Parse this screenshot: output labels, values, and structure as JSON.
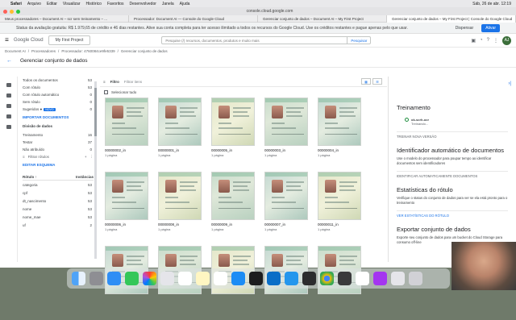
{
  "menubar": {
    "apple": "",
    "items": [
      "Safari",
      "Arquivo",
      "Editar",
      "Visualizar",
      "Histórico",
      "Favoritos",
      "Desenvolvedor",
      "Janela",
      "Ajuda"
    ],
    "datetime": "Sáb, 26 de abr. 12:19"
  },
  "browser": {
    "url": "console.cloud.google.com",
    "tabs": [
      "Meus processadores – Document AI – scr sem treinamento – ...",
      "Processador: Document AI — Console do Google Cloud",
      "Gerenciar conjunto de dados – Document AI – My First Project",
      "Gerenciar conjunto de dados – My First Project | Console do Google Cloud"
    ]
  },
  "banner": {
    "text": "Status da avaliação gratuita: R$ 1.979,65 de crédito e 46 dias restantes. Ative sua conta completa para ter acesso ilimitado a todos os recursos do Google Cloud. Use os créditos restantes e pague apenas pelo que usar.",
    "dismiss": "Dispensar",
    "activate": "Ativar"
  },
  "topbar": {
    "logo": "Google Cloud",
    "project": "My First Project",
    "search_placeholder": "Pesquise (/) recursos, documentos, produtos e muito mais",
    "search_button": "Pesquisar",
    "avatar": "AJ"
  },
  "breadcrumb": [
    "Document AI",
    "/",
    "Processadores",
    "/",
    "Processador: 4760084ce9fe5339",
    "/",
    "Gerenciar conjunto de dados"
  ],
  "page_title": "Gerenciar conjunto de dados",
  "left": {
    "counts": [
      {
        "label": "Todos os documentos",
        "value": "53"
      },
      {
        "label": "Com rótulo",
        "value": "53"
      },
      {
        "label": "Com rótulo automático",
        "value": "0"
      },
      {
        "label": "Sem rótulo",
        "value": "0"
      },
      {
        "label": "Sugeridos",
        "value": "0"
      }
    ],
    "suggest_badge": "NOVO",
    "import_btn": "IMPORTAR DOCUMENTOS",
    "split_head": "Divisão de dados",
    "split": [
      {
        "label": "Treinamento",
        "value": "16"
      },
      {
        "label": "Testar",
        "value": "37"
      },
      {
        "label": "Não atribuído",
        "value": "0"
      }
    ],
    "filter": "Filtrar rótulos",
    "edit_schema": "EDITAR ESQUEMA",
    "table_head": {
      "label": "Rótulo",
      "count": "Instâncias"
    },
    "labels": [
      {
        "label": "categoria",
        "value": "53"
      },
      {
        "label": "cpf",
        "value": "53"
      },
      {
        "label": "dt_nascimento",
        "value": "53"
      },
      {
        "label": "nome",
        "value": "53"
      },
      {
        "label": "nome_mae",
        "value": "53"
      },
      {
        "label": "uf",
        "value": "2"
      }
    ]
  },
  "main": {
    "filter_label": "Filtro",
    "filter_placeholder": "Filtrar itens",
    "select_all": "Selecionar tudo",
    "docs": [
      {
        "name": "00000002_in",
        "pages": "1 página"
      },
      {
        "name": "00000001_in",
        "pages": "1 página"
      },
      {
        "name": "00000005_in",
        "pages": "1 página"
      },
      {
        "name": "00000003_in",
        "pages": "1 página"
      },
      {
        "name": "00000004_in",
        "pages": "1 página"
      },
      {
        "name": "00000006_in",
        "pages": "1 página"
      },
      {
        "name": "00000008_in",
        "pages": "1 página"
      },
      {
        "name": "00000009_in",
        "pages": "1 página"
      },
      {
        "name": "00000007_in",
        "pages": "1 página"
      },
      {
        "name": "00000011_in",
        "pages": "1 página"
      },
      {
        "name": "",
        "pages": ""
      },
      {
        "name": "",
        "pages": ""
      },
      {
        "name": "",
        "pages": ""
      },
      {
        "name": "",
        "pages": ""
      },
      {
        "name": "",
        "pages": ""
      }
    ]
  },
  "right": {
    "training_title": "Treinamento",
    "version_name": "ok-scrh-ocr",
    "version_status": "Treinando...",
    "train_btn": "TREINAR NOVA VERSÃO",
    "ident_title": "Identificador automático de documentos",
    "ident_text": "Use o modelo do processador para poupar tempo ao identificar documentos sem identificadores",
    "ident_btn": "IDENTIFICAR AUTOMATICAMENTE DOCUMENTOS",
    "stats_title": "Estatísticas do rótulo",
    "stats_text": "Verifique o status do conjunto de dados para ver se ela está pronto para o treinamento",
    "stats_btn": "VER ESTATÍSTICAS DO RÓTULO",
    "export_title": "Exportar conjunto de dados",
    "export_text": "Exporte seu conjunto de dados para um bucket do Cloud Storage para consumo off-line"
  }
}
